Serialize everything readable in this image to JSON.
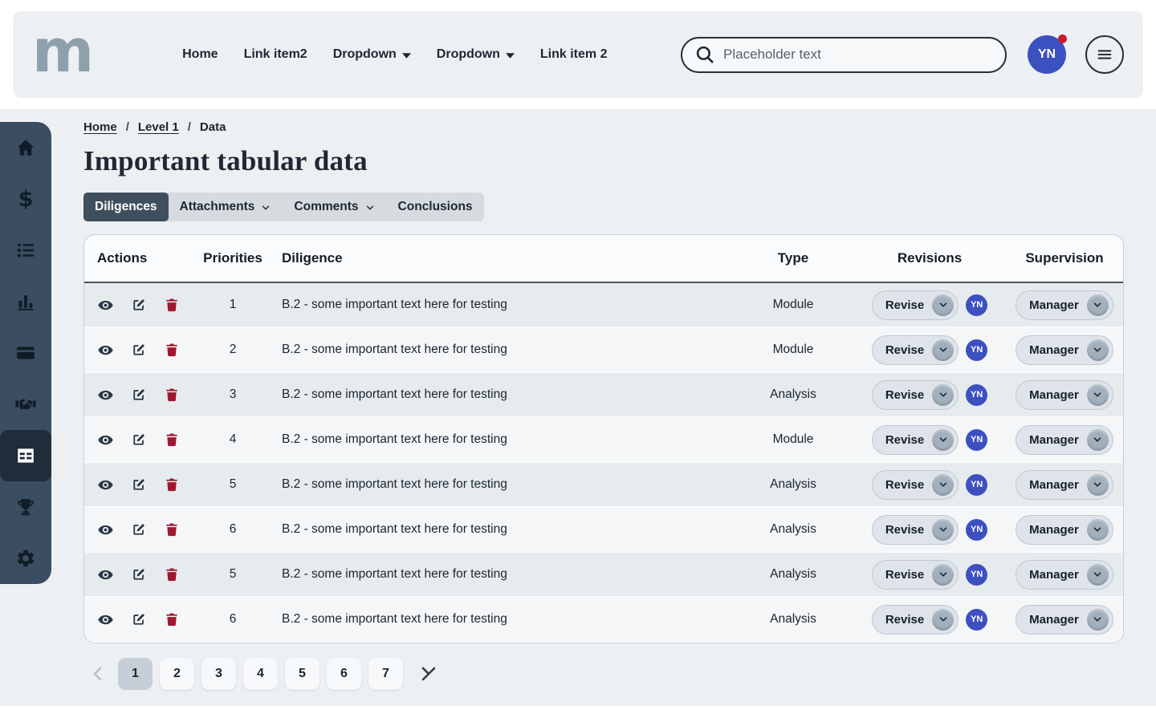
{
  "theme": {
    "accent_blue": "#3c50c0",
    "sidebar_bg": "#3b4e61",
    "sidebar_active_bg": "#1f2c39",
    "danger_red": "#a01830",
    "notification_red": "#c41d30",
    "tab_active_bg": "#404f5e"
  },
  "navbar": {
    "logo_text": "m",
    "items": [
      {
        "label": "Home",
        "dropdown": false
      },
      {
        "label": "Link item2",
        "dropdown": false
      },
      {
        "label": "Dropdown",
        "dropdown": true
      },
      {
        "label": "Dropdown",
        "dropdown": true
      },
      {
        "label": "Link item 2",
        "dropdown": false
      }
    ],
    "search": {
      "icon": "search-icon",
      "placeholder": "Placeholder text"
    },
    "avatar": {
      "initials": "YN",
      "has_notification": true
    },
    "menu_icon": "hamburger-icon"
  },
  "sidebar": {
    "items": [
      {
        "icon": "home",
        "active": false
      },
      {
        "icon": "dollar",
        "active": false
      },
      {
        "icon": "list",
        "active": false
      },
      {
        "icon": "bar-chart",
        "active": false
      },
      {
        "icon": "credit-card",
        "active": false
      },
      {
        "icon": "handshake",
        "active": false
      },
      {
        "icon": "table",
        "active": true
      },
      {
        "icon": "trophy",
        "active": false
      },
      {
        "icon": "gear",
        "active": false
      }
    ]
  },
  "breadcrumb": {
    "separator": "/",
    "items": [
      {
        "label": "Home",
        "link": true
      },
      {
        "label": "Level 1",
        "link": true
      },
      {
        "label": "Data",
        "link": false
      }
    ]
  },
  "page_title": "Important tabular data",
  "tabs": [
    {
      "label": "Diligences",
      "active": true,
      "dropdown": false
    },
    {
      "label": "Attachments",
      "active": false,
      "dropdown": true
    },
    {
      "label": "Comments",
      "active": false,
      "dropdown": true
    },
    {
      "label": "Conclusions",
      "active": false,
      "dropdown": false
    }
  ],
  "table": {
    "headers": {
      "actions": "Actions",
      "priorities": "Priorities",
      "diligence": "Diligence",
      "type": "Type",
      "revisions": "Revisions",
      "supervision": "Supervision"
    },
    "row_action_icons": [
      "eye-icon",
      "edit-icon",
      "trash-icon"
    ],
    "rows": [
      {
        "priority": "1",
        "diligence": "B.2 - some important text here for testing",
        "type": "Module",
        "revision": "Revise",
        "assignee": "YN",
        "supervision": "Manager"
      },
      {
        "priority": "2",
        "diligence": "B.2 - some important text here for testing",
        "type": "Module",
        "revision": "Revise",
        "assignee": "YN",
        "supervision": "Manager"
      },
      {
        "priority": "3",
        "diligence": "B.2 - some important text here for testing",
        "type": "Analysis",
        "revision": "Revise",
        "assignee": "YN",
        "supervision": "Manager"
      },
      {
        "priority": "4",
        "diligence": "B.2 - some important text here for testing",
        "type": "Module",
        "revision": "Revise",
        "assignee": "YN",
        "supervision": "Manager"
      },
      {
        "priority": "5",
        "diligence": "B.2 - some important text here for testing",
        "type": "Analysis",
        "revision": "Revise",
        "assignee": "YN",
        "supervision": "Manager"
      },
      {
        "priority": "6",
        "diligence": "B.2 - some important text here for testing",
        "type": "Analysis",
        "revision": "Revise",
        "assignee": "YN",
        "supervision": "Manager"
      },
      {
        "priority": "5",
        "diligence": "B.2 - some important text here for testing",
        "type": "Analysis",
        "revision": "Revise",
        "assignee": "YN",
        "supervision": "Manager"
      },
      {
        "priority": "6",
        "diligence": "B.2 - some important text here for testing",
        "type": "Analysis",
        "revision": "Revise",
        "assignee": "YN",
        "supervision": "Manager"
      }
    ]
  },
  "pagination": {
    "pages": [
      {
        "label": "1",
        "active": true
      },
      {
        "label": "2",
        "active": false
      },
      {
        "label": "3",
        "active": false
      },
      {
        "label": "4",
        "active": false
      },
      {
        "label": "5",
        "active": false
      },
      {
        "label": "6",
        "active": false
      },
      {
        "label": "7",
        "active": false
      }
    ]
  }
}
